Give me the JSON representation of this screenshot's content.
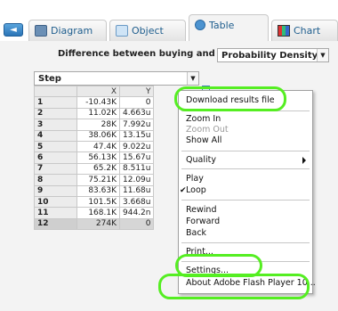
{
  "tabs": [
    {
      "label": "Diagram",
      "icon": "diagram-icon"
    },
    {
      "label": "Object",
      "icon": "object-icon"
    },
    {
      "label": "Table",
      "icon": "table-icon",
      "active": true
    },
    {
      "label": "Chart",
      "icon": "chart-icon"
    }
  ],
  "header": {
    "variable_label": "Difference between buying and renting ($)",
    "distribution_select": "Probability Density",
    "step_select": "Step"
  },
  "table": {
    "columns": [
      "",
      "X",
      "Y"
    ],
    "rows": [
      [
        "1",
        "-10.43K",
        "0"
      ],
      [
        "2",
        "11.02K",
        "4.663u"
      ],
      [
        "3",
        "28K",
        "7.992u"
      ],
      [
        "4",
        "38.06K",
        "13.15u"
      ],
      [
        "5",
        "47.4K",
        "9.022u"
      ],
      [
        "6",
        "56.13K",
        "15.67u"
      ],
      [
        "7",
        "65.2K",
        "8.511u"
      ],
      [
        "8",
        "75.21K",
        "12.09u"
      ],
      [
        "9",
        "83.63K",
        "11.68u"
      ],
      [
        "10",
        "101.5K",
        "3.668u"
      ],
      [
        "11",
        "168.1K",
        "944.2n"
      ],
      [
        "12",
        "274K",
        "0"
      ]
    ]
  },
  "context_menu": {
    "items": [
      {
        "label": "Download results file"
      },
      {
        "label": "Zoom In"
      },
      {
        "label": "Zoom Out",
        "disabled": true
      },
      {
        "label": "Show All"
      },
      {
        "label": "Quality",
        "submenu": true
      },
      {
        "label": "Play"
      },
      {
        "label": "Loop",
        "checked": true
      },
      {
        "label": "Rewind"
      },
      {
        "label": "Forward"
      },
      {
        "label": "Back"
      },
      {
        "label": "Print..."
      },
      {
        "label": "Settings..."
      },
      {
        "label": "About Adobe Flash Player 10..."
      }
    ],
    "check_mark": "✔"
  },
  "highlight_color": "#55ee22",
  "accent_color": "#1f5e8e"
}
